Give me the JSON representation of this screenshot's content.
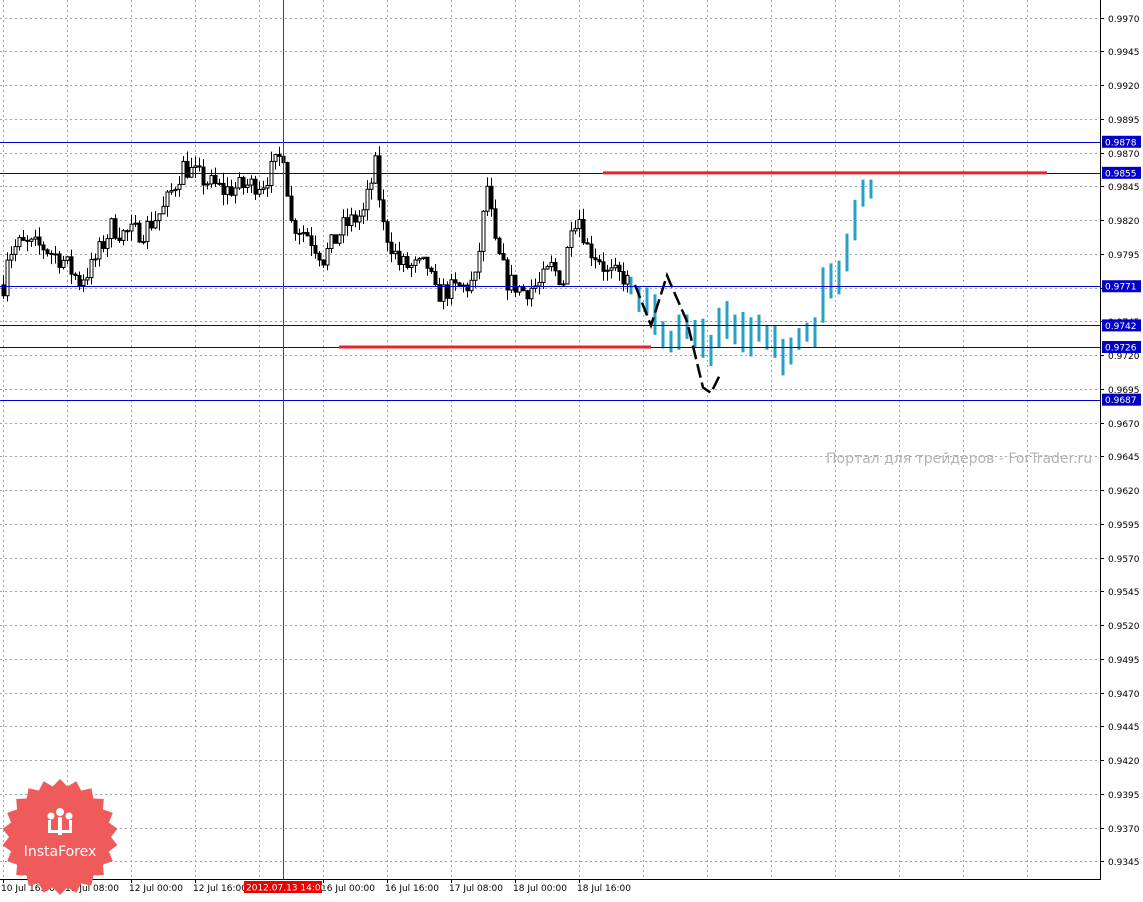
{
  "chart_data": {
    "type": "candlestick",
    "y_axis": {
      "range": [
        0.9332,
        0.9983
      ],
      "ticks": [
        "0.9970",
        "0.9945",
        "0.9920",
        "0.9895",
        "0.9870",
        "0.9845",
        "0.9820",
        "0.9795",
        "0.9770",
        "0.9745",
        "0.9720",
        "0.9695",
        "0.9670",
        "0.9645",
        "0.9620",
        "0.9595",
        "0.9570",
        "0.9545",
        "0.9520",
        "0.9495",
        "0.9470",
        "0.9445",
        "0.9420",
        "0.9395",
        "0.9370",
        "0.9345"
      ]
    },
    "x_axis": {
      "bar_count": 270,
      "labels": [
        {
          "bar": 0,
          "text": "10 Jul 16:00"
        },
        {
          "bar": 16,
          "text": "11 Jul 08:00"
        },
        {
          "bar": 32,
          "text": "12 Jul 00:00"
        },
        {
          "bar": 48,
          "text": "12 Jul 16:00"
        },
        {
          "bar": 80,
          "text": "16 Jul 00:00"
        },
        {
          "bar": 96,
          "text": "16 Jul 16:00"
        },
        {
          "bar": 112,
          "text": "17 Jul 08:00"
        },
        {
          "bar": 128,
          "text": "18 Jul 00:00"
        },
        {
          "bar": 144,
          "text": "18 Jul 16:00"
        }
      ],
      "cursor": {
        "bar": 70,
        "text": "2012.07.13 14:00"
      }
    },
    "horizontal_levels": [
      {
        "price": 0.9878,
        "label": "0.9878"
      },
      {
        "price": 0.9855,
        "label": "0.9855"
      },
      {
        "price": 0.9771,
        "label": "0.9771"
      },
      {
        "price": 0.9742,
        "label": "0.9742"
      },
      {
        "price": 0.9726,
        "label": "0.9726"
      },
      {
        "price": 0.9687,
        "label": "0.9687"
      }
    ],
    "target_lines": [
      {
        "price": 0.9855,
        "bar_from": 150,
        "bar_to": 261
      },
      {
        "price": 0.9726,
        "bar_from": 84,
        "bar_to": 162
      }
    ],
    "zigzag": [
      {
        "bar": 158,
        "price": 0.9772
      },
      {
        "bar": 162,
        "price": 0.9742
      },
      {
        "bar": 166,
        "price": 0.9779
      },
      {
        "bar": 167,
        "price": 0.9772
      },
      {
        "bar": 171,
        "price": 0.9745
      },
      {
        "bar": 175,
        "price": 0.9696
      },
      {
        "bar": 177,
        "price": 0.9692
      },
      {
        "bar": 179,
        "price": 0.9704
      }
    ],
    "forecast_bars": [
      {
        "bar": 157,
        "o": 0.9775,
        "h": 0.9778,
        "l": 0.9765,
        "c": 0.9768
      },
      {
        "bar": 159,
        "o": 0.9768,
        "h": 0.9771,
        "l": 0.9752,
        "c": 0.9756
      },
      {
        "bar": 161,
        "o": 0.9758,
        "h": 0.977,
        "l": 0.975,
        "c": 0.9764
      },
      {
        "bar": 163,
        "o": 0.9762,
        "h": 0.9765,
        "l": 0.9735,
        "c": 0.9738
      },
      {
        "bar": 165,
        "o": 0.9738,
        "h": 0.9745,
        "l": 0.9725,
        "c": 0.973
      },
      {
        "bar": 167,
        "o": 0.9732,
        "h": 0.9738,
        "l": 0.9722,
        "c": 0.9728
      },
      {
        "bar": 169,
        "o": 0.9728,
        "h": 0.975,
        "l": 0.9724,
        "c": 0.9746
      },
      {
        "bar": 171,
        "o": 0.9745,
        "h": 0.975,
        "l": 0.9732,
        "c": 0.9736
      },
      {
        "bar": 173,
        "o": 0.9738,
        "h": 0.9746,
        "l": 0.9725,
        "c": 0.9744
      },
      {
        "bar": 175,
        "o": 0.9742,
        "h": 0.9747,
        "l": 0.9718,
        "c": 0.9722
      },
      {
        "bar": 177,
        "o": 0.9722,
        "h": 0.9735,
        "l": 0.9712,
        "c": 0.973
      },
      {
        "bar": 179,
        "o": 0.973,
        "h": 0.9755,
        "l": 0.9726,
        "c": 0.975
      },
      {
        "bar": 181,
        "o": 0.975,
        "h": 0.976,
        "l": 0.9732,
        "c": 0.9736
      },
      {
        "bar": 183,
        "o": 0.9736,
        "h": 0.975,
        "l": 0.9728,
        "c": 0.9746
      },
      {
        "bar": 185,
        "o": 0.9746,
        "h": 0.9752,
        "l": 0.9722,
        "c": 0.9726
      },
      {
        "bar": 187,
        "o": 0.9726,
        "h": 0.9748,
        "l": 0.9719,
        "c": 0.9744
      },
      {
        "bar": 189,
        "o": 0.9744,
        "h": 0.975,
        "l": 0.973,
        "c": 0.9734
      },
      {
        "bar": 191,
        "o": 0.9734,
        "h": 0.9742,
        "l": 0.9724,
        "c": 0.9738
      },
      {
        "bar": 193,
        "o": 0.9738,
        "h": 0.9742,
        "l": 0.9718,
        "c": 0.9722
      },
      {
        "bar": 195,
        "o": 0.9722,
        "h": 0.9732,
        "l": 0.9705,
        "c": 0.9716
      },
      {
        "bar": 197,
        "o": 0.9716,
        "h": 0.9733,
        "l": 0.9713,
        "c": 0.973
      },
      {
        "bar": 199,
        "o": 0.9728,
        "h": 0.974,
        "l": 0.9724,
        "c": 0.9736
      },
      {
        "bar": 201,
        "o": 0.9736,
        "h": 0.9744,
        "l": 0.973,
        "c": 0.974
      },
      {
        "bar": 203,
        "o": 0.974,
        "h": 0.9748,
        "l": 0.9726,
        "c": 0.9745
      },
      {
        "bar": 205,
        "o": 0.9746,
        "h": 0.9785,
        "l": 0.9744,
        "c": 0.9782
      },
      {
        "bar": 207,
        "o": 0.977,
        "h": 0.9788,
        "l": 0.9762,
        "c": 0.9785
      },
      {
        "bar": 209,
        "o": 0.9775,
        "h": 0.979,
        "l": 0.9765,
        "c": 0.9786
      },
      {
        "bar": 211,
        "o": 0.9786,
        "h": 0.981,
        "l": 0.9782,
        "c": 0.9808
      },
      {
        "bar": 213,
        "o": 0.9808,
        "h": 0.9835,
        "l": 0.9805,
        "c": 0.9832
      },
      {
        "bar": 215,
        "o": 0.9832,
        "h": 0.985,
        "l": 0.983,
        "c": 0.9846
      },
      {
        "bar": 217,
        "o": 0.9846,
        "h": 0.985,
        "l": 0.9836,
        "c": 0.9842
      }
    ],
    "colors": {
      "candles": "#000000",
      "forecast": "#26a1c6",
      "levels": "#0000c8",
      "targets": "#ee2222",
      "cursor": "#ee0000",
      "grid": "#9aa5b1"
    },
    "grid": true
  },
  "watermark": "Портал для трейдеров - ForTrader.ru",
  "logo": {
    "text": "InstaForex",
    "color": "#ef5a5a"
  }
}
